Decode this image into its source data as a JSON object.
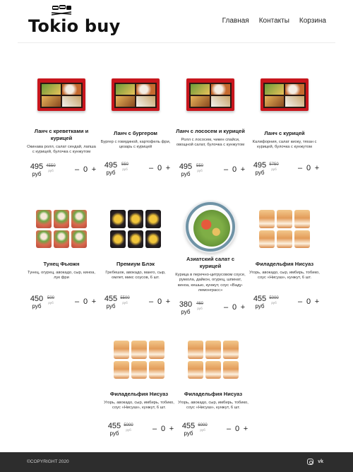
{
  "brand": {
    "name": "Tokio buy"
  },
  "nav": {
    "home": "Главная",
    "contacts": "Контакты",
    "cart": "Корзина"
  },
  "products": [
    {
      "name": "Ланч с креветками и курицей",
      "desc": "Окинава ролл, салат сендай, лапша с курицей, булочка с кунжутом",
      "price": "495",
      "currency": "руб",
      "old_price": "4550",
      "old_currency": "руб",
      "qty": "0",
      "image": "bento-shrimp-chicken"
    },
    {
      "name": "Ланч с бургером",
      "desc": "Бургер с говядиной, картофель фри, цезарь с курицей",
      "price": "495",
      "currency": "руб",
      "old_price": "550",
      "old_currency": "руб",
      "qty": "0",
      "image": "bento-burger"
    },
    {
      "name": "Ланч с лососем и курицей",
      "desc": "Ролл с лососем, чикен спайси, овощной салат, булочка с кунжутом",
      "price": "495",
      "currency": "руб",
      "old_price": "550",
      "old_currency": "руб",
      "qty": "0",
      "image": "bento-salmon-chicken"
    },
    {
      "name": "Ланч с курицей",
      "desc": "Калифорния, салат киоку, тяхан с курицей, булочка с кунжутом",
      "price": "495",
      "currency": "руб",
      "old_price": "5750",
      "old_currency": "руб",
      "qty": "0",
      "image": "bento-chicken"
    },
    {
      "name": "Тунец Фьюжн",
      "desc": "Тунец, огурец, авокадо, сыр, киноа, лук фри",
      "price": "450",
      "currency": "руб",
      "old_price": "500",
      "old_currency": "руб",
      "qty": "0",
      "image": "roll-tuna"
    },
    {
      "name": "Премиум Блэк",
      "desc": "Гребешок, авокадо, манго, сыр, омлет, микс соусов, 6 шт.",
      "price": "455",
      "currency": "руб",
      "old_price": "5500",
      "old_currency": "руб",
      "qty": "0",
      "image": "roll-black"
    },
    {
      "name": "Азиатский салат с курицей",
      "desc": "Курица в перечно-цитрусовом соусе, руккола, дайкон, огурец, шпинат, киноа, кешью, кунжут, соус «Ваду-лемонграсс»",
      "price": "380",
      "currency": "руб",
      "old_price": "460",
      "old_currency": "руб",
      "qty": "0",
      "image": "salad-bowl"
    },
    {
      "name": "Филадельфия Нисуаз",
      "desc": "Угорь, авокадо, сыр, имбирь, тобико, соус «Нисуаз», кунжут, 6 шт.",
      "price": "455",
      "currency": "руб",
      "old_price": "5000",
      "old_currency": "руб",
      "qty": "0",
      "image": "roll-philadelphia"
    },
    {
      "name": "Филадельфия Нисуаз",
      "desc": "Угорь, авокадо, сыр, имбирь, тобико, соус «Нисуаз», кунжут, 6 шт.",
      "price": "455",
      "currency": "руб",
      "old_price": "5000",
      "old_currency": "руб",
      "qty": "0",
      "image": "roll-philadelphia"
    },
    {
      "name": "Филадельфия Нисуаз",
      "desc": "Угорь, авокадо, сыр, имбирь, тобико, соус «Нисуаз», кунжут, 6 шт.",
      "price": "455",
      "currency": "руб",
      "old_price": "6000",
      "old_currency": "руб",
      "qty": "0",
      "image": "roll-philadelphia"
    }
  ],
  "qty_controls": {
    "minus": "–",
    "plus": "+"
  },
  "footer": {
    "copyright": "©COPYRIGHT 2020",
    "vk": "vk"
  },
  "icons": {
    "instagram": "instagram-icon",
    "vk": "vk-icon",
    "logo": "sushi-logo-icon"
  },
  "colors": {
    "bento_red": "#c8161d",
    "footer_bg": "#2d2d2d"
  }
}
